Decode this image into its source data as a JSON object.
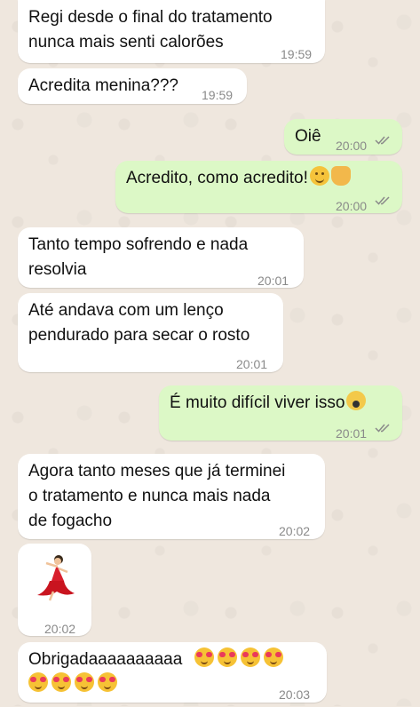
{
  "messages": [
    {
      "id": "m1",
      "direction": "incoming",
      "lines": [
        "Regi desde o final do tratamento",
        "nunca mais senti calorões"
      ],
      "time": "19:59"
    },
    {
      "id": "m2",
      "direction": "incoming",
      "lines": [
        "Acredita menina???"
      ],
      "time": "19:59"
    },
    {
      "id": "m3",
      "direction": "outgoing",
      "lines": [
        "Oiê"
      ],
      "time": "20:00",
      "status": "read"
    },
    {
      "id": "m4",
      "direction": "outgoing",
      "lines": [
        "Acredito, como acredito!"
      ],
      "emojis": [
        "smiling-face",
        "folded-hands"
      ],
      "time": "20:00",
      "status": "read"
    },
    {
      "id": "m5",
      "direction": "incoming",
      "lines": [
        "Tanto tempo sofrendo e nada",
        "resolvia"
      ],
      "time": "20:01"
    },
    {
      "id": "m6",
      "direction": "incoming",
      "lines": [
        "Até andava com um lenço",
        "pendurado para secar o rosto"
      ],
      "time": "20:01"
    },
    {
      "id": "m7",
      "direction": "outgoing",
      "lines": [
        "É muito difícil viver isso"
      ],
      "emojis": [
        "face-screaming"
      ],
      "time": "20:01",
      "status": "read"
    },
    {
      "id": "m8",
      "direction": "incoming",
      "lines": [
        "Agora tanto meses que já terminei",
        "o tratamento e nunca mais nada",
        "de fogacho"
      ],
      "time": "20:02"
    },
    {
      "id": "m9",
      "direction": "incoming",
      "type": "sticker",
      "emoji": "woman-dancing",
      "time": "20:02"
    },
    {
      "id": "m10",
      "direction": "incoming",
      "lines": [
        "Obrigadaaaaaaaaaa"
      ],
      "emojis": [
        "smiling-face-with-hearts",
        "smiling-face-with-hearts",
        "smiling-face-with-hearts",
        "smiling-face-with-hearts",
        "smiling-face-with-hearts",
        "smiling-face-with-hearts",
        "smiling-face-with-hearts",
        "smiling-face-with-hearts"
      ],
      "time": "20:03"
    }
  ],
  "colors": {
    "incoming_bubble": "#ffffff",
    "outgoing_bubble": "#dcf8c6",
    "wallpaper": "#efe7de",
    "read_ticks": "#8a8a8a"
  }
}
